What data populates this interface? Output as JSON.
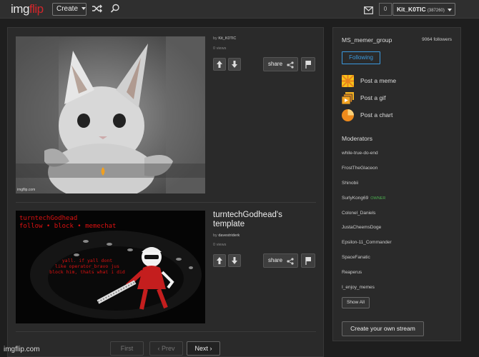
{
  "header": {
    "logo_a": "img",
    "logo_b": "flip",
    "create_label": "Create",
    "notif_count": "0",
    "username": "Kit_K0TIC",
    "points": "(387260)"
  },
  "posts": [
    {
      "title": "",
      "author": "Kit_K0TIC",
      "views": "0 views",
      "share_label": "share",
      "watermark": "imgflip.com"
    },
    {
      "title": "turntechGodhead's template",
      "author": "davestriderk",
      "views": "0 views",
      "share_label": "share",
      "overlay_top": "turntechGodhead\nfollow • block • memechat",
      "overlay_caption": "yall. if yall dont\nlike operator_bravo jus\nblock him, thats what i did"
    }
  ],
  "by_prefix": "by",
  "pagination": {
    "first": "First",
    "prev": "‹ Prev",
    "next": "Next ›"
  },
  "sidebar": {
    "group_name": "MS_memer_group",
    "followers": "9064 followers",
    "following_label": "Following",
    "actions": [
      "Post a meme",
      "Post a gif",
      "Post a chart"
    ],
    "moderators_heading": "Moderators",
    "moderators": [
      "while-true-do-end",
      "FrostTheGlaceon",
      "Shinobii",
      "SurlyKong69",
      "Colonel_Daniels",
      "JustaCheemsDoge",
      "Epsilon-11_Commander",
      "SpaceFanatic",
      "Reaperus",
      "I_enjoy_memes"
    ],
    "owner_tag": "OWNER",
    "show_all": "Show All",
    "create_stream": "Create your own stream"
  },
  "footer_watermark": "imgflip.com",
  "colors": {
    "accent_red": "#d1262b",
    "following_blue": "#3a9ae0",
    "owner_green": "#4caf50"
  }
}
